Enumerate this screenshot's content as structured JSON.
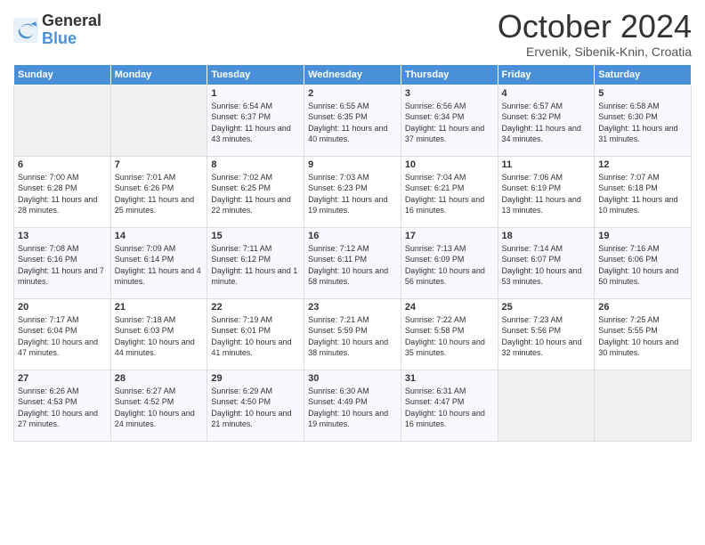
{
  "header": {
    "logo_general": "General",
    "logo_blue": "Blue",
    "month": "October 2024",
    "location": "Ervenik, Sibenik-Knin, Croatia"
  },
  "days_of_week": [
    "Sunday",
    "Monday",
    "Tuesday",
    "Wednesday",
    "Thursday",
    "Friday",
    "Saturday"
  ],
  "weeks": [
    [
      {
        "day": "",
        "info": ""
      },
      {
        "day": "",
        "info": ""
      },
      {
        "day": "1",
        "info": "Sunrise: 6:54 AM\nSunset: 6:37 PM\nDaylight: 11 hours and 43 minutes."
      },
      {
        "day": "2",
        "info": "Sunrise: 6:55 AM\nSunset: 6:35 PM\nDaylight: 11 hours and 40 minutes."
      },
      {
        "day": "3",
        "info": "Sunrise: 6:56 AM\nSunset: 6:34 PM\nDaylight: 11 hours and 37 minutes."
      },
      {
        "day": "4",
        "info": "Sunrise: 6:57 AM\nSunset: 6:32 PM\nDaylight: 11 hours and 34 minutes."
      },
      {
        "day": "5",
        "info": "Sunrise: 6:58 AM\nSunset: 6:30 PM\nDaylight: 11 hours and 31 minutes."
      }
    ],
    [
      {
        "day": "6",
        "info": "Sunrise: 7:00 AM\nSunset: 6:28 PM\nDaylight: 11 hours and 28 minutes."
      },
      {
        "day": "7",
        "info": "Sunrise: 7:01 AM\nSunset: 6:26 PM\nDaylight: 11 hours and 25 minutes."
      },
      {
        "day": "8",
        "info": "Sunrise: 7:02 AM\nSunset: 6:25 PM\nDaylight: 11 hours and 22 minutes."
      },
      {
        "day": "9",
        "info": "Sunrise: 7:03 AM\nSunset: 6:23 PM\nDaylight: 11 hours and 19 minutes."
      },
      {
        "day": "10",
        "info": "Sunrise: 7:04 AM\nSunset: 6:21 PM\nDaylight: 11 hours and 16 minutes."
      },
      {
        "day": "11",
        "info": "Sunrise: 7:06 AM\nSunset: 6:19 PM\nDaylight: 11 hours and 13 minutes."
      },
      {
        "day": "12",
        "info": "Sunrise: 7:07 AM\nSunset: 6:18 PM\nDaylight: 11 hours and 10 minutes."
      }
    ],
    [
      {
        "day": "13",
        "info": "Sunrise: 7:08 AM\nSunset: 6:16 PM\nDaylight: 11 hours and 7 minutes."
      },
      {
        "day": "14",
        "info": "Sunrise: 7:09 AM\nSunset: 6:14 PM\nDaylight: 11 hours and 4 minutes."
      },
      {
        "day": "15",
        "info": "Sunrise: 7:11 AM\nSunset: 6:12 PM\nDaylight: 11 hours and 1 minute."
      },
      {
        "day": "16",
        "info": "Sunrise: 7:12 AM\nSunset: 6:11 PM\nDaylight: 10 hours and 58 minutes."
      },
      {
        "day": "17",
        "info": "Sunrise: 7:13 AM\nSunset: 6:09 PM\nDaylight: 10 hours and 56 minutes."
      },
      {
        "day": "18",
        "info": "Sunrise: 7:14 AM\nSunset: 6:07 PM\nDaylight: 10 hours and 53 minutes."
      },
      {
        "day": "19",
        "info": "Sunrise: 7:16 AM\nSunset: 6:06 PM\nDaylight: 10 hours and 50 minutes."
      }
    ],
    [
      {
        "day": "20",
        "info": "Sunrise: 7:17 AM\nSunset: 6:04 PM\nDaylight: 10 hours and 47 minutes."
      },
      {
        "day": "21",
        "info": "Sunrise: 7:18 AM\nSunset: 6:03 PM\nDaylight: 10 hours and 44 minutes."
      },
      {
        "day": "22",
        "info": "Sunrise: 7:19 AM\nSunset: 6:01 PM\nDaylight: 10 hours and 41 minutes."
      },
      {
        "day": "23",
        "info": "Sunrise: 7:21 AM\nSunset: 5:59 PM\nDaylight: 10 hours and 38 minutes."
      },
      {
        "day": "24",
        "info": "Sunrise: 7:22 AM\nSunset: 5:58 PM\nDaylight: 10 hours and 35 minutes."
      },
      {
        "day": "25",
        "info": "Sunrise: 7:23 AM\nSunset: 5:56 PM\nDaylight: 10 hours and 32 minutes."
      },
      {
        "day": "26",
        "info": "Sunrise: 7:25 AM\nSunset: 5:55 PM\nDaylight: 10 hours and 30 minutes."
      }
    ],
    [
      {
        "day": "27",
        "info": "Sunrise: 6:26 AM\nSunset: 4:53 PM\nDaylight: 10 hours and 27 minutes."
      },
      {
        "day": "28",
        "info": "Sunrise: 6:27 AM\nSunset: 4:52 PM\nDaylight: 10 hours and 24 minutes."
      },
      {
        "day": "29",
        "info": "Sunrise: 6:29 AM\nSunset: 4:50 PM\nDaylight: 10 hours and 21 minutes."
      },
      {
        "day": "30",
        "info": "Sunrise: 6:30 AM\nSunset: 4:49 PM\nDaylight: 10 hours and 19 minutes."
      },
      {
        "day": "31",
        "info": "Sunrise: 6:31 AM\nSunset: 4:47 PM\nDaylight: 10 hours and 16 minutes."
      },
      {
        "day": "",
        "info": ""
      },
      {
        "day": "",
        "info": ""
      }
    ]
  ]
}
